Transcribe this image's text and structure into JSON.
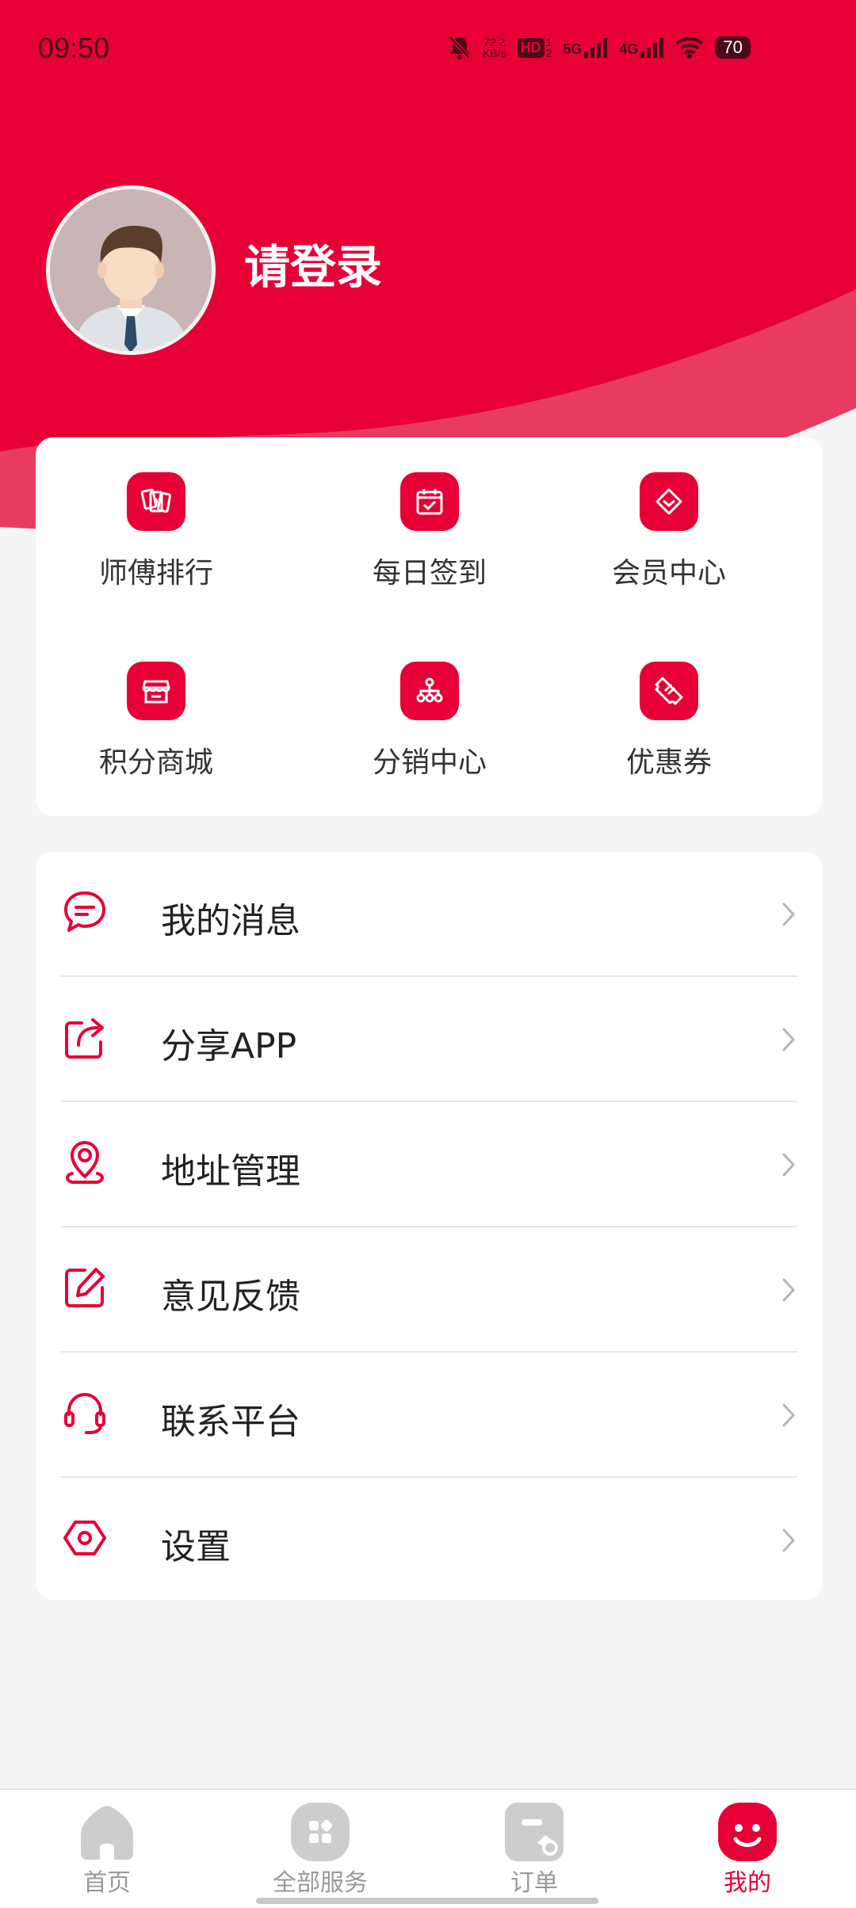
{
  "status_bar": {
    "time": "09:50",
    "net_speed_value": "72.2",
    "net_speed_unit": "KB/s",
    "hd_label": "HD",
    "sim_numbers_top": "1",
    "sim_numbers_bottom": "2",
    "network_5g": "5G",
    "network_4g": "4G",
    "battery": "70"
  },
  "profile": {
    "login_text": "请登录"
  },
  "grid": {
    "items": [
      {
        "label": "师傅排行",
        "icon": "ranking-icon"
      },
      {
        "label": "每日签到",
        "icon": "calendar-check-icon"
      },
      {
        "label": "会员中心",
        "icon": "diamond-icon"
      },
      {
        "label": "积分商城",
        "icon": "store-icon"
      },
      {
        "label": "分销中心",
        "icon": "org-chart-icon"
      },
      {
        "label": "优惠券",
        "icon": "coupon-icon"
      }
    ]
  },
  "menu": {
    "items": [
      {
        "label": "我的消息",
        "icon": "message-icon"
      },
      {
        "label": "分享APP",
        "icon": "share-icon"
      },
      {
        "label": "地址管理",
        "icon": "location-icon"
      },
      {
        "label": "意见反馈",
        "icon": "edit-icon"
      },
      {
        "label": "联系平台",
        "icon": "headset-icon"
      },
      {
        "label": "设置",
        "icon": "settings-icon"
      }
    ]
  },
  "tab_bar": {
    "tabs": [
      {
        "label": "首页",
        "icon": "home-icon",
        "active": false
      },
      {
        "label": "全部服务",
        "icon": "grid-icon",
        "active": false
      },
      {
        "label": "订单",
        "icon": "order-icon",
        "active": false
      },
      {
        "label": "我的",
        "icon": "profile-face-icon",
        "active": true
      }
    ]
  },
  "colors": {
    "brand": "#e60036",
    "background": "#f5f5f5",
    "inactive_tab": "#999999"
  }
}
